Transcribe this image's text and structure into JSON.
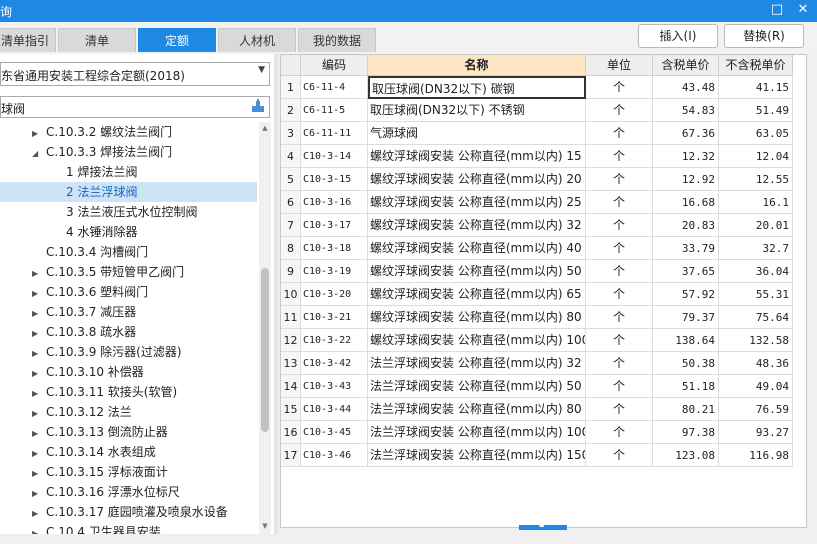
{
  "window": {
    "title_fragment": "询",
    "restore_glyph": "□",
    "close_glyph": "✕"
  },
  "tabs": [
    {
      "label": "清单指引",
      "active": false
    },
    {
      "label": "清单",
      "active": false
    },
    {
      "label": "定额",
      "active": true
    },
    {
      "label": "人材机",
      "active": false
    },
    {
      "label": "我的数据",
      "active": false
    }
  ],
  "buttons": {
    "insert": "插入(I)",
    "replace": "替换(R)"
  },
  "combo": {
    "value": "东省通用安装工程综合定额(2018)"
  },
  "search": {
    "value": "球阀",
    "icon": "filter-icon"
  },
  "tree": [
    {
      "label": "C.10.3.2  螺纹法兰阀门",
      "caret": "▶"
    },
    {
      "label": "C.10.3.3  焊接法兰阀门",
      "caret": "◢"
    },
    {
      "label": "1 焊接法兰阀",
      "caret": ""
    },
    {
      "label": "2 法兰浮球阀",
      "caret": "",
      "selected": true
    },
    {
      "label": "3 法兰液压式水位控制阀",
      "caret": ""
    },
    {
      "label": "4 水锤消除器",
      "caret": ""
    },
    {
      "label": "C.10.3.4  沟槽阀门",
      "caret": ""
    },
    {
      "label": "C.10.3.5  带短管甲乙阀门",
      "caret": "▶"
    },
    {
      "label": "C.10.3.6  塑料阀门",
      "caret": "▶"
    },
    {
      "label": "C.10.3.7  减压器",
      "caret": "▶"
    },
    {
      "label": "C.10.3.8  疏水器",
      "caret": "▶"
    },
    {
      "label": "C.10.3.9  除污器(过滤器)",
      "caret": "▶"
    },
    {
      "label": "C.10.3.10  补偿器",
      "caret": "▶"
    },
    {
      "label": "C.10.3.11  软接头(软管)",
      "caret": "▶"
    },
    {
      "label": "C.10.3.12  法兰",
      "caret": "▶"
    },
    {
      "label": "C.10.3.13  倒流防止器",
      "caret": "▶"
    },
    {
      "label": "C.10.3.14  水表组成",
      "caret": "▶"
    },
    {
      "label": "C.10.3.15  浮标液面计",
      "caret": "▶"
    },
    {
      "label": "C.10.3.16  浮漂水位标尺",
      "caret": "▶"
    },
    {
      "label": "C.10.3.17  庭园喷灌及喷泉水设备",
      "caret": "▶"
    },
    {
      "label": "C.10.4  卫生器具安装",
      "caret": "▶"
    }
  ],
  "grid": {
    "headers": {
      "num": "",
      "code": "编码",
      "name": "名称",
      "unit": "单位",
      "price_tax": "含税单价",
      "price_notax": "不含税单价"
    },
    "rows": [
      {
        "num": "1",
        "code": "C6-11-4",
        "name": "取压球阀(DN32以下) 碳钢",
        "unit": "个",
        "price_tax": "43.48",
        "price_notax": "41.15"
      },
      {
        "num": "2",
        "code": "C6-11-5",
        "name": "取压球阀(DN32以下) 不锈钢",
        "unit": "个",
        "price_tax": "54.83",
        "price_notax": "51.49"
      },
      {
        "num": "3",
        "code": "C6-11-11",
        "name": "气源球阀",
        "unit": "个",
        "price_tax": "67.36",
        "price_notax": "63.05"
      },
      {
        "num": "4",
        "code": "C10-3-14",
        "name": "螺纹浮球阀安装 公称直径(mm以内) 15",
        "unit": "个",
        "price_tax": "12.32",
        "price_notax": "12.04"
      },
      {
        "num": "5",
        "code": "C10-3-15",
        "name": "螺纹浮球阀安装 公称直径(mm以内) 20",
        "unit": "个",
        "price_tax": "12.92",
        "price_notax": "12.55"
      },
      {
        "num": "6",
        "code": "C10-3-16",
        "name": "螺纹浮球阀安装 公称直径(mm以内) 25",
        "unit": "个",
        "price_tax": "16.68",
        "price_notax": "16.1"
      },
      {
        "num": "7",
        "code": "C10-3-17",
        "name": "螺纹浮球阀安装 公称直径(mm以内) 32",
        "unit": "个",
        "price_tax": "20.83",
        "price_notax": "20.01"
      },
      {
        "num": "8",
        "code": "C10-3-18",
        "name": "螺纹浮球阀安装 公称直径(mm以内) 40",
        "unit": "个",
        "price_tax": "33.79",
        "price_notax": "32.7"
      },
      {
        "num": "9",
        "code": "C10-3-19",
        "name": "螺纹浮球阀安装 公称直径(mm以内) 50",
        "unit": "个",
        "price_tax": "37.65",
        "price_notax": "36.04"
      },
      {
        "num": "10",
        "code": "C10-3-20",
        "name": "螺纹浮球阀安装 公称直径(mm以内) 65",
        "unit": "个",
        "price_tax": "57.92",
        "price_notax": "55.31"
      },
      {
        "num": "11",
        "code": "C10-3-21",
        "name": "螺纹浮球阀安装 公称直径(mm以内) 80",
        "unit": "个",
        "price_tax": "79.37",
        "price_notax": "75.64"
      },
      {
        "num": "12",
        "code": "C10-3-22",
        "name": "螺纹浮球阀安装 公称直径(mm以内) 100",
        "unit": "个",
        "price_tax": "138.64",
        "price_notax": "132.58"
      },
      {
        "num": "13",
        "code": "C10-3-42",
        "name": "法兰浮球阀安装 公称直径(mm以内) 32",
        "unit": "个",
        "price_tax": "50.38",
        "price_notax": "48.36"
      },
      {
        "num": "14",
        "code": "C10-3-43",
        "name": "法兰浮球阀安装 公称直径(mm以内) 50",
        "unit": "个",
        "price_tax": "51.18",
        "price_notax": "49.04"
      },
      {
        "num": "15",
        "code": "C10-3-44",
        "name": "法兰浮球阀安装 公称直径(mm以内) 80",
        "unit": "个",
        "price_tax": "80.21",
        "price_notax": "76.59"
      },
      {
        "num": "16",
        "code": "C10-3-45",
        "name": "法兰浮球阀安装 公称直径(mm以内) 100",
        "unit": "个",
        "price_tax": "97.38",
        "price_notax": "93.27"
      },
      {
        "num": "17",
        "code": "C10-3-46",
        "name": "法兰浮球阀安装 公称直径(mm以内) 150",
        "unit": "个",
        "price_tax": "123.08",
        "price_notax": "116.98"
      }
    ]
  },
  "colors": {
    "accent": "#1e88e5",
    "selected_row": "#cfe3f6",
    "name_header": "#fde7c2"
  }
}
